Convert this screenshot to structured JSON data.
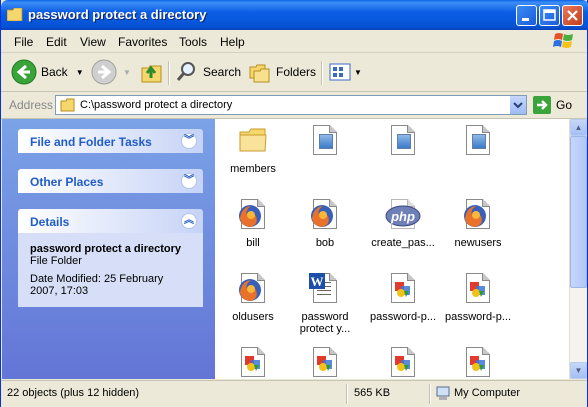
{
  "window": {
    "title": "password protect a directory"
  },
  "menu": [
    "File",
    "Edit",
    "View",
    "Favorites",
    "Tools",
    "Help"
  ],
  "toolbar": {
    "back": "Back",
    "search": "Search",
    "folders": "Folders"
  },
  "address": {
    "label": "Address",
    "path": "C:\\password protect a directory",
    "go": "Go"
  },
  "tasks": {
    "file_folder": "File and Folder Tasks",
    "other_places": "Other Places",
    "details": "Details",
    "details_name": "password protect a directory",
    "details_type": "File Folder",
    "details_modified": "Date Modified: 25 February 2007, 17:03"
  },
  "files": [
    {
      "label": "members",
      "icon": "folder-icon"
    },
    {
      "label": "",
      "icon": "document-icon"
    },
    {
      "label": "",
      "icon": "document-icon"
    },
    {
      "label": "",
      "icon": "document-icon"
    },
    {
      "label": "bill",
      "icon": "firefox-html-icon"
    },
    {
      "label": "bob",
      "icon": "firefox-html-icon"
    },
    {
      "label": "create_pas...",
      "icon": "php-file-icon"
    },
    {
      "label": "newusers",
      "icon": "firefox-html-icon"
    },
    {
      "label": "oldusers",
      "icon": "firefox-html-icon"
    },
    {
      "label": "password protect y...",
      "icon": "word-document-icon"
    },
    {
      "label": "password-p...",
      "icon": "image-file-icon"
    },
    {
      "label": "password-p...",
      "icon": "image-file-icon"
    },
    {
      "label": "",
      "icon": "image-file-icon"
    },
    {
      "label": "",
      "icon": "image-file-icon"
    },
    {
      "label": "",
      "icon": "image-file-icon"
    },
    {
      "label": "",
      "icon": "image-file-icon"
    }
  ],
  "status": {
    "objects": "22 objects (plus 12 hidden)",
    "size": "565 KB",
    "location": "My Computer"
  }
}
